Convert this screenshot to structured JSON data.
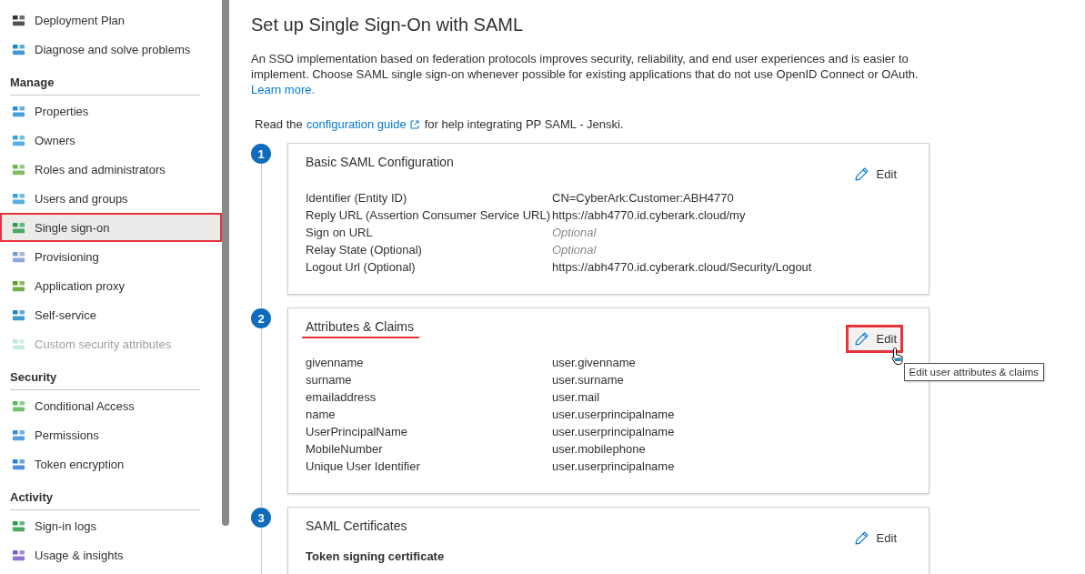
{
  "sidebar": {
    "sections": [
      {
        "items": [
          {
            "label": "Deployment Plan",
            "selected": false,
            "disabled": false,
            "highlighted": false
          },
          {
            "label": "Diagnose and solve problems",
            "selected": false,
            "disabled": false,
            "highlighted": false
          }
        ]
      },
      {
        "heading": "Manage",
        "items": [
          {
            "label": "Properties",
            "selected": false,
            "disabled": false,
            "highlighted": false
          },
          {
            "label": "Owners",
            "selected": false,
            "disabled": false,
            "highlighted": false
          },
          {
            "label": "Roles and administrators",
            "selected": false,
            "disabled": false,
            "highlighted": false
          },
          {
            "label": "Users and groups",
            "selected": false,
            "disabled": false,
            "highlighted": false
          },
          {
            "label": "Single sign-on",
            "selected": true,
            "disabled": false,
            "highlighted": true
          },
          {
            "label": "Provisioning",
            "selected": false,
            "disabled": false,
            "highlighted": false
          },
          {
            "label": "Application proxy",
            "selected": false,
            "disabled": false,
            "highlighted": false
          },
          {
            "label": "Self-service",
            "selected": false,
            "disabled": false,
            "highlighted": false
          },
          {
            "label": "Custom security attributes",
            "selected": false,
            "disabled": true,
            "highlighted": false
          }
        ]
      },
      {
        "heading": "Security",
        "items": [
          {
            "label": "Conditional Access",
            "selected": false,
            "disabled": false,
            "highlighted": false
          },
          {
            "label": "Permissions",
            "selected": false,
            "disabled": false,
            "highlighted": false
          },
          {
            "label": "Token encryption",
            "selected": false,
            "disabled": false,
            "highlighted": false
          }
        ]
      },
      {
        "heading": "Activity",
        "items": [
          {
            "label": "Sign-in logs",
            "selected": false,
            "disabled": false,
            "highlighted": false
          },
          {
            "label": "Usage & insights",
            "selected": false,
            "disabled": false,
            "highlighted": false
          }
        ]
      }
    ]
  },
  "page": {
    "title": "Set up Single Sign-On with SAML",
    "intro": "An SSO implementation based on federation protocols improves security, reliability, and end user experiences and is easier to implement. Choose SAML single sign-on whenever possible for existing applications that do not use OpenID Connect or OAuth.",
    "intro_link": "Learn more.",
    "guide_before": "Read the",
    "guide_link": "configuration guide",
    "guide_after": "for help integrating PP SAML - Jenski."
  },
  "steps": [
    {
      "number": "1",
      "title": "Basic SAML Configuration",
      "title_underlined": false,
      "edit": {
        "label": "Edit",
        "highlighted": false
      },
      "rows": [
        {
          "label": "Identifier (Entity ID)",
          "value": "CN=CyberArk:Customer:ABH4770",
          "kind": "value"
        },
        {
          "label": "Reply URL (Assertion Consumer Service URL)",
          "value": "https://abh4770.id.cyberark.cloud/my",
          "kind": "value"
        },
        {
          "label": "Sign on URL",
          "value": "Optional",
          "kind": "optional"
        },
        {
          "label": "Relay State (Optional)",
          "value": "Optional",
          "kind": "optional"
        },
        {
          "label": "Logout Url (Optional)",
          "value": "https://abh4770.id.cyberark.cloud/Security/Logout",
          "kind": "value"
        }
      ]
    },
    {
      "number": "2",
      "title": "Attributes & Claims",
      "title_underlined": true,
      "edit": {
        "label": "Edit",
        "highlighted": true,
        "tooltip": "Edit user attributes & claims"
      },
      "rows": [
        {
          "label": "givenname",
          "value": "user.givenname",
          "kind": "value"
        },
        {
          "label": "surname",
          "value": "user.surname",
          "kind": "value"
        },
        {
          "label": "emailaddress",
          "value": "user.mail",
          "kind": "value"
        },
        {
          "label": "name",
          "value": "user.userprincipalname",
          "kind": "value"
        },
        {
          "label": "UserPrincipalName",
          "value": "user.userprincipalname",
          "kind": "value"
        },
        {
          "label": "MobileNumber",
          "value": "user.mobilephone",
          "kind": "value"
        },
        {
          "label": "Unique User Identifier",
          "value": "user.userprincipalname",
          "kind": "value"
        }
      ]
    },
    {
      "number": "3",
      "title": "SAML Certificates",
      "title_underlined": false,
      "edit": {
        "label": "Edit",
        "highlighted": false
      },
      "subtitle": "Token signing certificate"
    }
  ]
}
